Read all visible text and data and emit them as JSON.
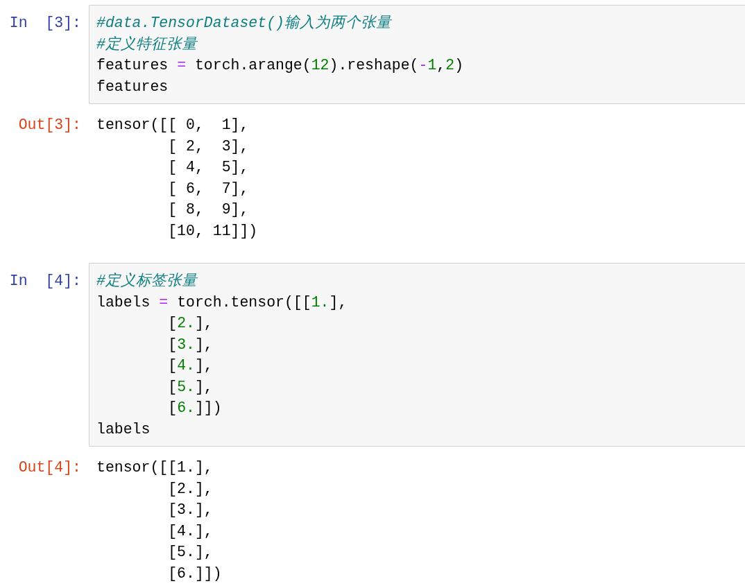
{
  "cells": [
    {
      "kind": "input",
      "prompt": "In  [3]:",
      "lines": [
        [
          {
            "kind": "comment",
            "text": "#data.TensorDataset()输入为两个张量"
          }
        ],
        [
          {
            "kind": "comment",
            "text": "#定义特征张量"
          }
        ],
        [
          {
            "kind": "text",
            "text": "features "
          },
          {
            "kind": "operator",
            "text": "="
          },
          {
            "kind": "text",
            "text": " torch.arange("
          },
          {
            "kind": "number",
            "text": "12"
          },
          {
            "kind": "text",
            "text": ").reshape("
          },
          {
            "kind": "operator",
            "text": "-"
          },
          {
            "kind": "number",
            "text": "1"
          },
          {
            "kind": "text",
            "text": ","
          },
          {
            "kind": "number",
            "text": "2"
          },
          {
            "kind": "text",
            "text": ")"
          }
        ],
        [
          {
            "kind": "text",
            "text": "features"
          }
        ]
      ]
    },
    {
      "kind": "output",
      "prompt": "Out[3]:",
      "lines": [
        "tensor([[ 0,  1],",
        "        [ 2,  3],",
        "        [ 4,  5],",
        "        [ 6,  7],",
        "        [ 8,  9],",
        "        [10, 11]])"
      ]
    },
    {
      "kind": "input",
      "prompt": "In  [4]:",
      "lines": [
        [
          {
            "kind": "comment",
            "text": "#定义标签张量"
          }
        ],
        [
          {
            "kind": "text",
            "text": "labels "
          },
          {
            "kind": "operator",
            "text": "="
          },
          {
            "kind": "text",
            "text": " torch.tensor([["
          },
          {
            "kind": "number",
            "text": "1."
          },
          {
            "kind": "text",
            "text": "],"
          }
        ],
        [
          {
            "kind": "text",
            "text": "        ["
          },
          {
            "kind": "number",
            "text": "2."
          },
          {
            "kind": "text",
            "text": "],"
          }
        ],
        [
          {
            "kind": "text",
            "text": "        ["
          },
          {
            "kind": "number",
            "text": "3."
          },
          {
            "kind": "text",
            "text": "],"
          }
        ],
        [
          {
            "kind": "text",
            "text": "        ["
          },
          {
            "kind": "number",
            "text": "4."
          },
          {
            "kind": "text",
            "text": "],"
          }
        ],
        [
          {
            "kind": "text",
            "text": "        ["
          },
          {
            "kind": "number",
            "text": "5."
          },
          {
            "kind": "text",
            "text": "],"
          }
        ],
        [
          {
            "kind": "text",
            "text": "        ["
          },
          {
            "kind": "number",
            "text": "6."
          },
          {
            "kind": "text",
            "text": "]])"
          }
        ],
        [
          {
            "kind": "text",
            "text": "labels"
          }
        ]
      ]
    },
    {
      "kind": "output",
      "prompt": "Out[4]:",
      "lines": [
        "tensor([[1.],",
        "        [2.],",
        "        [3.],",
        "        [4.],",
        "        [5.],",
        "        [6.]])"
      ]
    }
  ]
}
